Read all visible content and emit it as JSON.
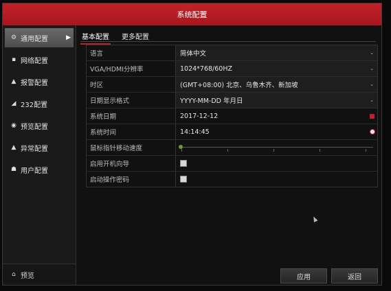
{
  "window": {
    "title": "系统配置"
  },
  "sidebar": {
    "items": [
      {
        "label": "通用配置",
        "icon": "gear-icon",
        "active": true
      },
      {
        "label": "网络配置",
        "icon": "network-icon"
      },
      {
        "label": "报警配置",
        "icon": "alarm-icon"
      },
      {
        "label": "232配置",
        "icon": "serial-icon"
      },
      {
        "label": "预览配置",
        "icon": "eye-icon"
      },
      {
        "label": "异常配置",
        "icon": "warning-icon"
      },
      {
        "label": "用户配置",
        "icon": "users-icon"
      }
    ],
    "bottom": {
      "label": "预览",
      "icon": "home-icon"
    }
  },
  "tabs": [
    {
      "label": "基本配置",
      "active": true
    },
    {
      "label": "更多配置"
    }
  ],
  "settings": [
    {
      "label": "语言",
      "value": "简体中文",
      "control": "select"
    },
    {
      "label": "VGA/HDMI分辨率",
      "value": "1024*768/60HZ",
      "control": "select"
    },
    {
      "label": "时区",
      "value": "(GMT+08:00) 北京、乌鲁木齐、新加坡",
      "control": "select"
    },
    {
      "label": "日期显示格式",
      "value": "YYYY-MM-DD 年月日",
      "control": "select"
    },
    {
      "label": "系统日期",
      "value": "2017-12-12",
      "control": "date"
    },
    {
      "label": "系统时间",
      "value": "14:14:45",
      "control": "time"
    },
    {
      "label": "鼠标指针移动速度",
      "value": "",
      "control": "slider"
    },
    {
      "label": "启用开机向导",
      "value": "",
      "control": "checkbox"
    },
    {
      "label": "启动操作密码",
      "value": "",
      "control": "checkbox"
    }
  ],
  "buttons": {
    "apply": "应用",
    "back": "返回"
  },
  "colors": {
    "accent": "#c1222a",
    "background": "#111111"
  }
}
